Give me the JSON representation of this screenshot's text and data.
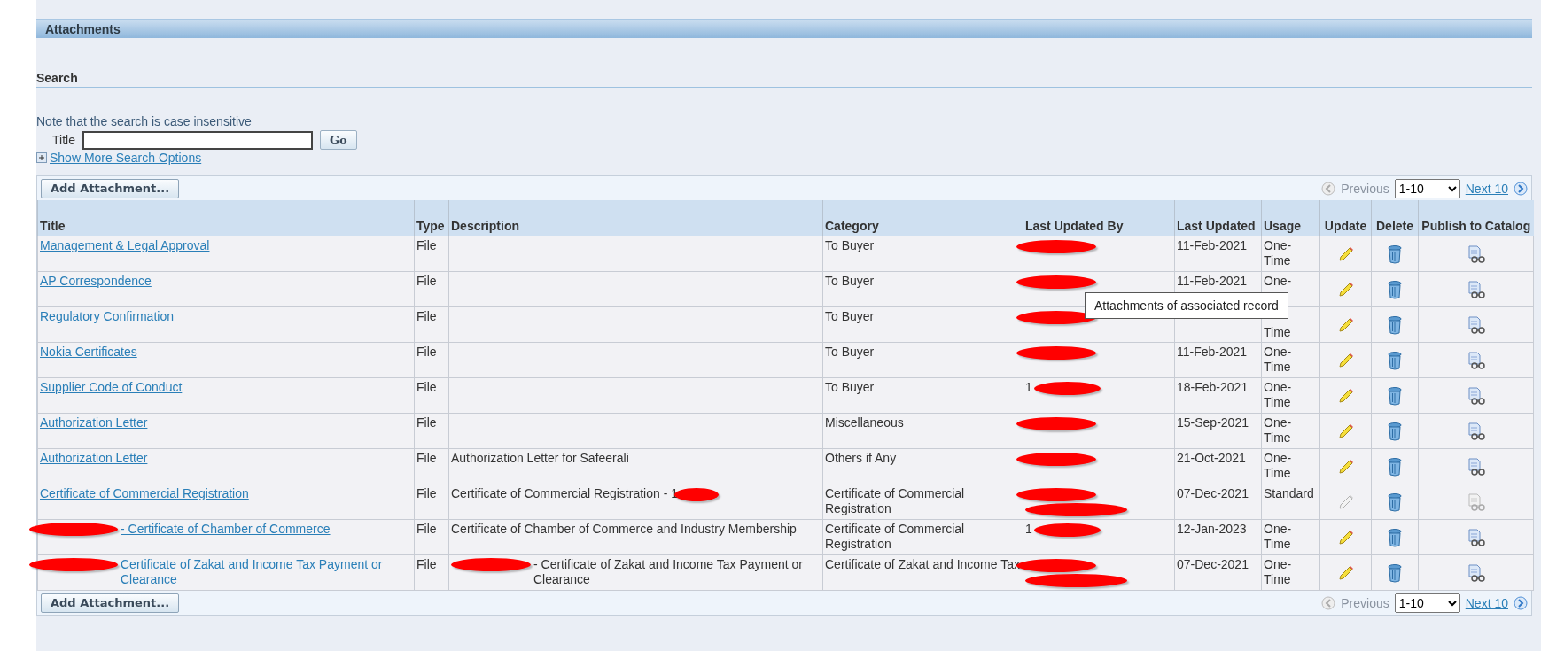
{
  "region": {
    "title": "Attachments"
  },
  "search": {
    "title": "Search",
    "note": "Note that the search is case insensitive",
    "field_label": "Title",
    "go": "Go",
    "more_options": "Show More Search Options"
  },
  "toolbars": [
    {
      "add": "Add Attachment...",
      "previous": "Previous",
      "previous_disabled": true,
      "range": "1-10",
      "next": "Next 10"
    },
    {
      "add": "Add Attachment...",
      "previous": "Previous",
      "previous_disabled": true,
      "range": "1-10",
      "next": "Next 10"
    }
  ],
  "tooltip": {
    "text": "Attachments of associated record"
  },
  "columns": [
    "Title",
    "Type",
    "Description",
    "Category",
    "Last Updated By",
    "Last Updated",
    "Usage",
    "Update",
    "Delete",
    "Publish to Catalog"
  ],
  "rows": [
    {
      "title": {
        "text": "Management & Legal Approval",
        "redacted": false
      },
      "type": "File",
      "description": {
        "redacted": false
      },
      "category": "To Buyer",
      "last_updated_by": {
        "redacted": true,
        "two_lines": false
      },
      "last_updated": "11-Feb-2021",
      "usage": "One-Time",
      "update_disabled": false,
      "publish_disabled": false
    },
    {
      "title": {
        "text": "AP Correspondence",
        "redacted": false
      },
      "type": "File",
      "description": {
        "redacted": false
      },
      "category": "To Buyer",
      "last_updated_by": {
        "redacted": true,
        "two_lines": false
      },
      "last_updated": "11-Feb-2021",
      "usage": "One-",
      "update_disabled": false,
      "publish_disabled": false
    },
    {
      "title": {
        "text": "Regulatory Confirmation",
        "redacted": false
      },
      "type": "File",
      "description": {
        "redacted": false
      },
      "category": "To Buyer",
      "last_updated_by": {
        "redacted": true,
        "two_lines": false
      },
      "usage": "Time",
      "update_disabled": false,
      "publish_disabled": false
    },
    {
      "title": {
        "text": "Nokia Certificates",
        "redacted": false
      },
      "type": "File",
      "description": {
        "redacted": false
      },
      "category": "To Buyer",
      "last_updated_by": {
        "redacted": true,
        "two_lines": false
      },
      "last_updated": "11-Feb-2021",
      "usage": "One-Time",
      "update_disabled": false,
      "publish_disabled": false
    },
    {
      "title": {
        "text": "Supplier Code of Conduct",
        "redacted": false
      },
      "type": "File",
      "description": {
        "redacted": false
      },
      "category": "To Buyer",
      "last_updated_by": {
        "text": "1",
        "redacted": true,
        "two_lines": false
      },
      "last_updated": "18-Feb-2021",
      "usage": "One-Time",
      "update_disabled": false,
      "publish_disabled": false
    },
    {
      "title": {
        "text": "Authorization Letter",
        "redacted": false
      },
      "type": "File",
      "description": {
        "redacted": false
      },
      "category": "Miscellaneous",
      "last_updated_by": {
        "redacted": true,
        "two_lines": false
      },
      "last_updated": "15-Sep-2021",
      "usage": "One-Time",
      "update_disabled": false,
      "publish_disabled": false
    },
    {
      "title": {
        "text": "Authorization Letter",
        "redacted": false
      },
      "type": "File",
      "description": {
        "text": "Authorization Letter for Safeerali",
        "redacted": false
      },
      "category": "Others if Any",
      "last_updated_by": {
        "redacted": true,
        "two_lines": false
      },
      "last_updated": "21-Oct-2021",
      "usage": "One-Time",
      "update_disabled": false,
      "publish_disabled": false
    },
    {
      "title": {
        "text": "Certificate of Commercial Registration",
        "redacted": false
      },
      "type": "File",
      "description": {
        "text": "Certificate of Commercial Registration - 1",
        "redacted": true,
        "redaction_first": false
      },
      "category": "Certificate of Commercial Registration",
      "last_updated_by": {
        "redacted": true,
        "two_lines": true
      },
      "last_updated": "07-Dec-2021",
      "usage": "Standard",
      "update_disabled": true,
      "publish_disabled": true
    },
    {
      "title": {
        "text": "- Certificate of Chamber of Commerce",
        "redacted": true
      },
      "type": "File",
      "description": {
        "text": "Certificate of Chamber of Commerce and Industry Membership",
        "redacted": false
      },
      "category": "Certificate of Commercial Registration",
      "last_updated_by": {
        "text": "1",
        "redacted": true,
        "two_lines": false
      },
      "last_updated": "12-Jan-2023",
      "usage": "One-Time",
      "update_disabled": false,
      "publish_disabled": false
    },
    {
      "title": {
        "text": "Certificate of Zakat and Income Tax Payment or Clearance",
        "redacted": true
      },
      "type": "File",
      "description": {
        "text": "- Certificate of Zakat and Income Tax Payment or Clearance",
        "redacted": true,
        "redaction_first": true
      },
      "category": "Certificate of Zakat and Income Tax",
      "last_updated_by": {
        "redacted": true,
        "two_lines": true
      },
      "last_updated": "07-Dec-2021",
      "usage": "One-Time",
      "update_disabled": false,
      "publish_disabled": false
    }
  ]
}
